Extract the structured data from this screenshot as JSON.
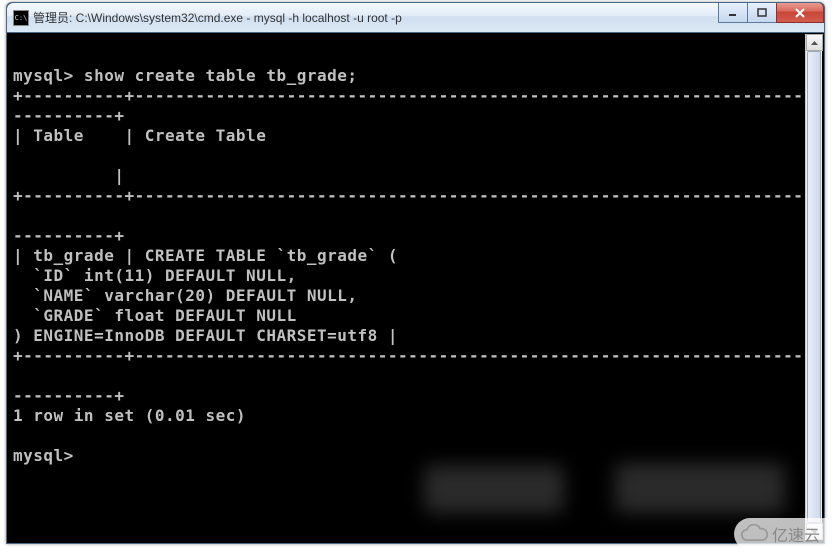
{
  "window": {
    "icon_text": "C:\\",
    "title": "管理员: C:\\Windows\\system32\\cmd.exe - mysql  -h localhost -u root -p"
  },
  "terminal": {
    "lines": [
      "",
      "mysql> show create table tb_grade;",
      "+----------+-----------------------------------------------------------------------------------------------------------------------------------------------",
      "----------+",
      "| Table    | Create Table",
      "",
      "          |",
      "+----------+-----------------------------------------------------------------------------------------------------------------------------------------------",
      "",
      "----------+",
      "| tb_grade | CREATE TABLE `tb_grade` (",
      "  `ID` int(11) DEFAULT NULL,",
      "  `NAME` varchar(20) DEFAULT NULL,",
      "  `GRADE` float DEFAULT NULL",
      ") ENGINE=InnoDB DEFAULT CHARSET=utf8 |",
      "+----------+-----------------------------------------------------------------------------------------------------------------------------------------------",
      "",
      "----------+",
      "1 row in set (0.01 sec)",
      "",
      "mysql>"
    ]
  },
  "watermark": {
    "text": "亿速云"
  }
}
